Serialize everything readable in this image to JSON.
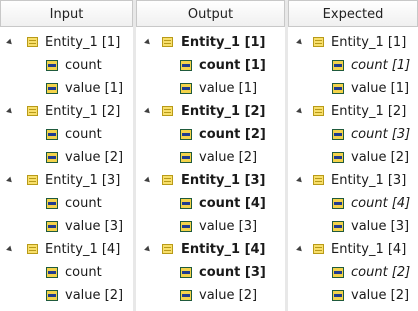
{
  "columns": {
    "input": {
      "header": "Input",
      "entities": [
        {
          "label": "Entity_1 [1]",
          "fields": [
            {
              "label": "count"
            },
            {
              "label": "value [1]"
            }
          ]
        },
        {
          "label": "Entity_1 [2]",
          "fields": [
            {
              "label": "count"
            },
            {
              "label": "value [2]"
            }
          ]
        },
        {
          "label": "Entity_1 [3]",
          "fields": [
            {
              "label": "count"
            },
            {
              "label": "value [3]"
            }
          ]
        },
        {
          "label": "Entity_1 [4]",
          "fields": [
            {
              "label": "count"
            },
            {
              "label": "value [2]"
            }
          ]
        }
      ]
    },
    "output": {
      "header": "Output",
      "entities": [
        {
          "label": "Entity_1 [1]",
          "bold": true,
          "fields": [
            {
              "label": "count [1]",
              "bold": true
            },
            {
              "label": "value [1]"
            }
          ]
        },
        {
          "label": "Entity_1 [2]",
          "bold": true,
          "fields": [
            {
              "label": "count [2]",
              "bold": true
            },
            {
              "label": "value [2]"
            }
          ]
        },
        {
          "label": "Entity_1 [3]",
          "bold": true,
          "fields": [
            {
              "label": "count [4]",
              "bold": true
            },
            {
              "label": "value [3]"
            }
          ]
        },
        {
          "label": "Entity_1 [4]",
          "bold": true,
          "fields": [
            {
              "label": "count [3]",
              "bold": true
            },
            {
              "label": "value [2]"
            }
          ]
        }
      ]
    },
    "expected": {
      "header": "Expected",
      "entities": [
        {
          "label": "Entity_1 [1]",
          "fields": [
            {
              "label": "count [1]",
              "italic": true
            },
            {
              "label": "value [1]"
            }
          ]
        },
        {
          "label": "Entity_1 [2]",
          "fields": [
            {
              "label": "count [3]",
              "italic": true
            },
            {
              "label": "value [2]"
            }
          ]
        },
        {
          "label": "Entity_1 [3]",
          "fields": [
            {
              "label": "count [4]",
              "italic": true
            },
            {
              "label": "value [3]"
            }
          ]
        },
        {
          "label": "Entity_1 [4]",
          "fields": [
            {
              "label": "count [2]",
              "italic": true
            },
            {
              "label": "value [2]"
            }
          ]
        }
      ]
    }
  },
  "icons": {
    "expander": "collapse-triangle-icon",
    "entity": "entity-icon",
    "field": "field-icon"
  },
  "colors": {
    "entity_icon": "#f8df6b",
    "field_icon_fill": "#f3d34a",
    "field_icon_bar": "#1f3b8f"
  }
}
